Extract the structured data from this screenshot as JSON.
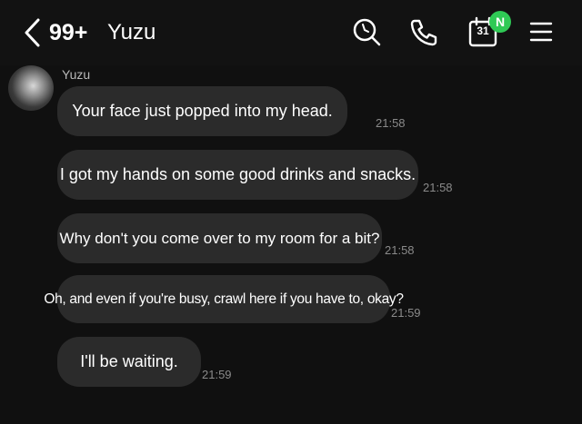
{
  "header": {
    "unread_count": "99+",
    "title": "Yuzu",
    "calendar_day": "31",
    "calendar_badge": "N",
    "badge_color": "#2fc955"
  },
  "icons": {
    "back": "chevron-left-icon",
    "search": "search-icon",
    "call": "phone-icon",
    "calendar": "calendar-icon",
    "menu": "hamburger-menu-icon"
  },
  "chat": {
    "sender_name": "Yuzu",
    "messages": [
      {
        "text": "Your face just popped into my head.",
        "time": "21:58"
      },
      {
        "text": "I got my hands on some good drinks and snacks.",
        "time": "21:58"
      },
      {
        "text": "Why don't you come over to my room for a bit?",
        "time": "21:58"
      },
      {
        "text": "Oh, and even if you're busy, crawl here if you have to, okay?",
        "time": "21:59"
      },
      {
        "text": "I'll be waiting.",
        "time": "21:59"
      }
    ]
  }
}
